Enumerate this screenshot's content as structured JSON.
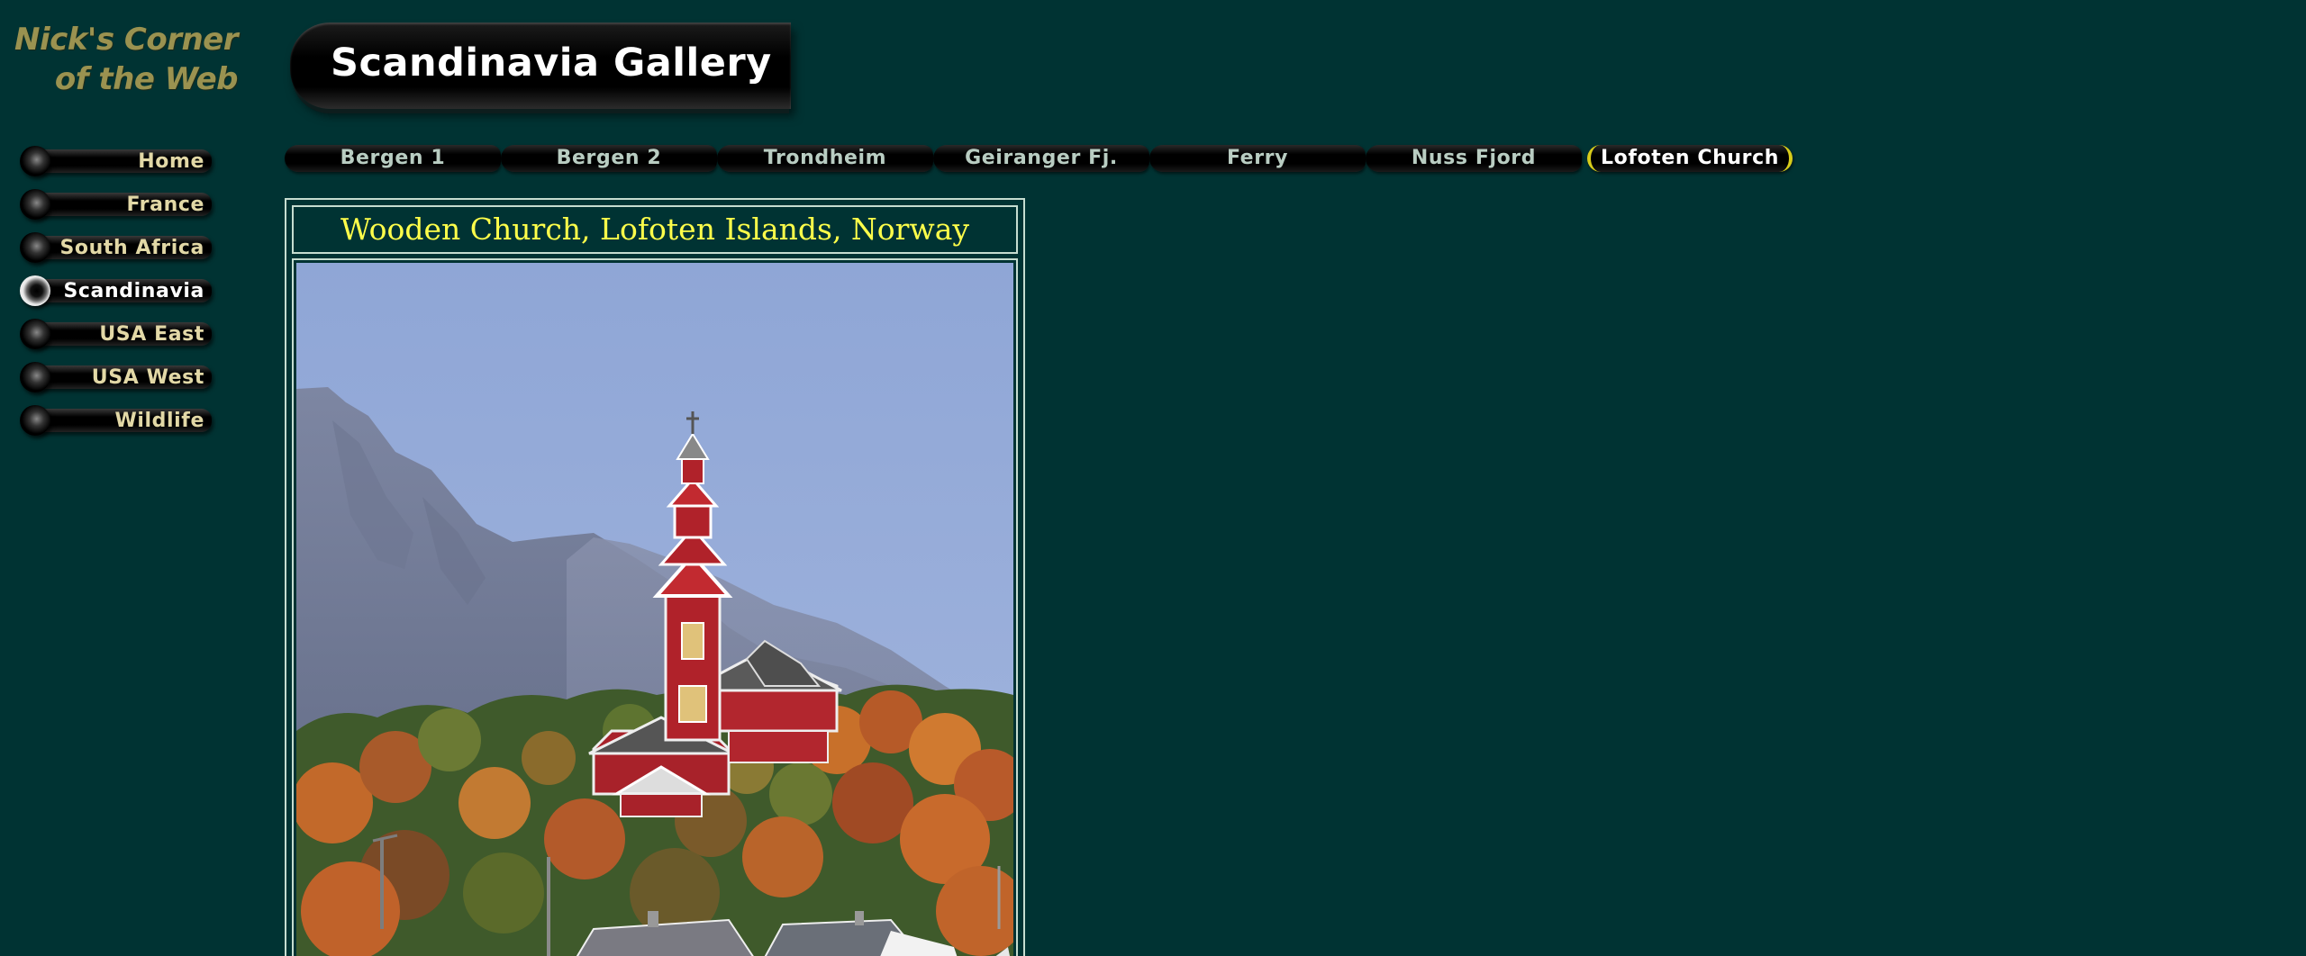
{
  "site": {
    "logo_line1": "Nick's Corner",
    "logo_line2": "of the Web"
  },
  "banner": {
    "title": "Scandinavia Gallery"
  },
  "side_nav": {
    "items": [
      {
        "label": "Home",
        "active": false
      },
      {
        "label": "France",
        "active": false
      },
      {
        "label": "South Africa",
        "active": false
      },
      {
        "label": "Scandinavia",
        "active": true
      },
      {
        "label": "USA East",
        "active": false
      },
      {
        "label": "USA West",
        "active": false
      },
      {
        "label": "Wildlife",
        "active": false
      }
    ]
  },
  "top_nav": {
    "tabs": [
      {
        "label": "Bergen 1",
        "active": false
      },
      {
        "label": "Bergen 2",
        "active": false
      },
      {
        "label": "Trondheim",
        "active": false
      },
      {
        "label": "Geiranger Fj.",
        "active": false
      },
      {
        "label": "Ferry",
        "active": false
      },
      {
        "label": "Nuss Fjord",
        "active": false
      },
      {
        "label": "Lofoten Church",
        "active": true
      }
    ]
  },
  "photo": {
    "caption": "Wooden Church, Lofoten Islands, Norway"
  },
  "colors": {
    "background": "#003333",
    "caption_text": "#ffff4a",
    "nav_text": "#e2d8a6",
    "active_accent": "#d8cc1a"
  }
}
